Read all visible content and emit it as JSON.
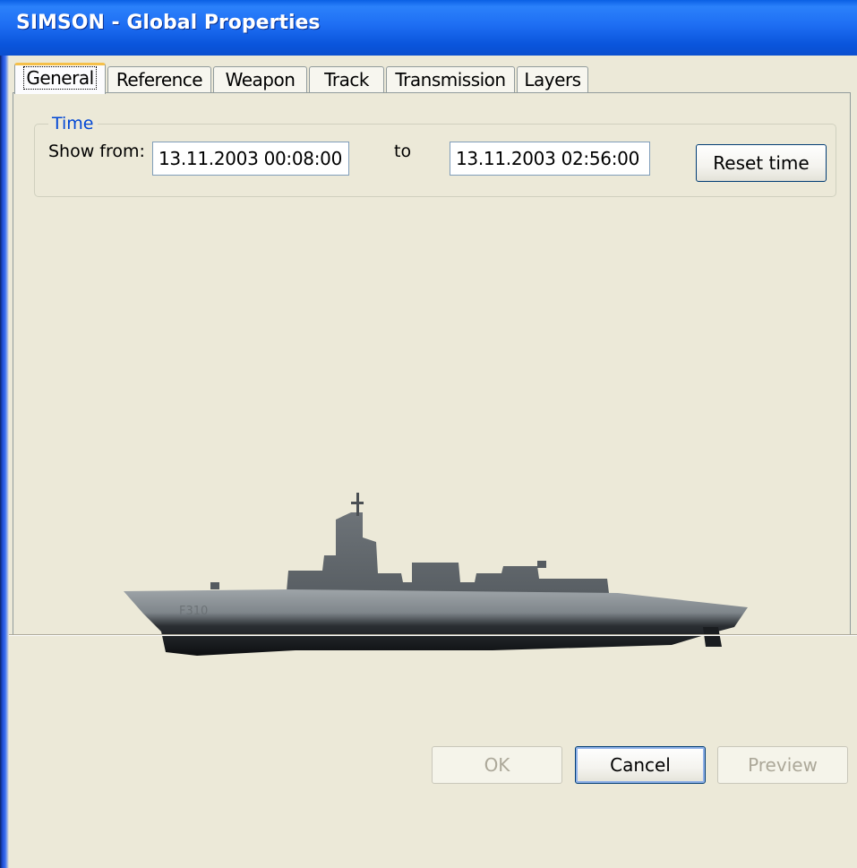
{
  "window": {
    "title": "SIMSON - Global Properties"
  },
  "tabs": [
    {
      "label": "General",
      "active": true
    },
    {
      "label": "Reference",
      "active": false
    },
    {
      "label": "Weapon",
      "active": false
    },
    {
      "label": "Track",
      "active": false
    },
    {
      "label": "Transmission",
      "active": false
    },
    {
      "label": "Layers",
      "active": false
    }
  ],
  "time_group": {
    "title": "Time",
    "show_from_label": "Show from:",
    "from_value": "13.11.2003 00:08:00",
    "to_label": "to",
    "to_value": "13.11.2003 02:56:00",
    "reset_label": "Reset time"
  },
  "image": {
    "hull_marking": "F310"
  },
  "footer": {
    "ok_label": "OK",
    "cancel_label": "Cancel",
    "preview_label": "Preview"
  },
  "colors": {
    "titlebar": "#1e6ef3",
    "group_title": "#0046d5",
    "dialog_bg": "#ece9d8"
  }
}
